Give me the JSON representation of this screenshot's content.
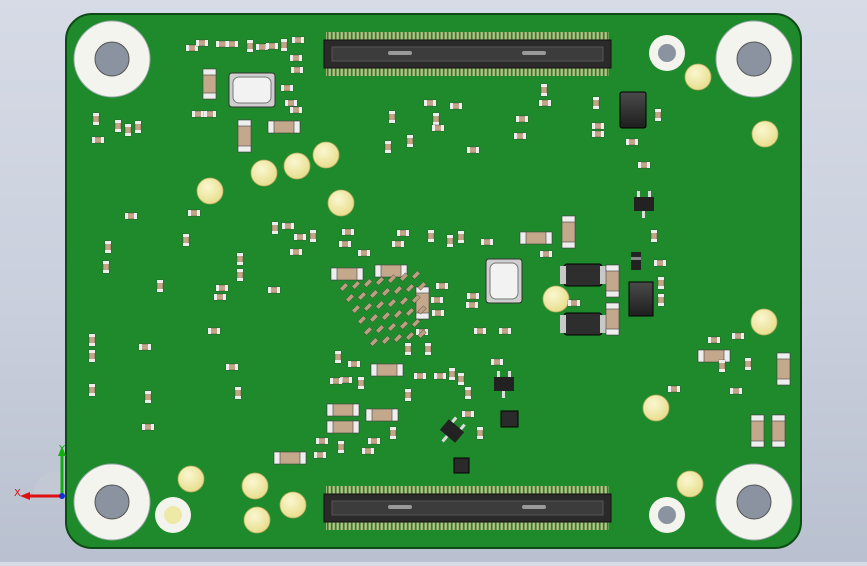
{
  "scene": {
    "board_color": "#1f8a2c",
    "board_edge": "#0f4f18",
    "pad_color": "#efe9a8",
    "hole_color": "#8a939f"
  },
  "triad": {
    "x_label": "X",
    "y_label": "Y",
    "x_color": "#e01010",
    "y_color": "#10b010"
  }
}
